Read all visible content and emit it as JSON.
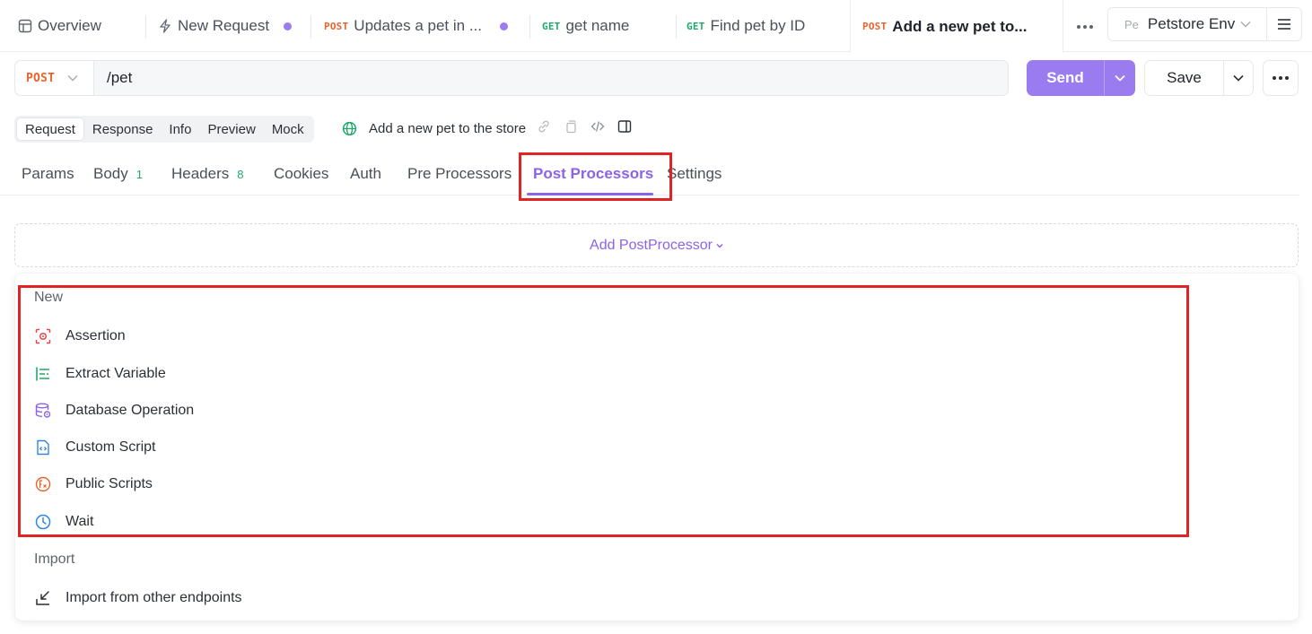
{
  "tabs": [
    {
      "label": "Overview",
      "method": "",
      "icon": "layout-icon",
      "unsaved": false,
      "active": false
    },
    {
      "label": "New Request",
      "method": "",
      "icon": "lightning-icon",
      "unsaved": true,
      "active": false
    },
    {
      "label": "Updates a pet in ...",
      "method": "POST",
      "unsaved": true,
      "active": false
    },
    {
      "label": "get name",
      "method": "GET",
      "unsaved": false,
      "active": false
    },
    {
      "label": "Find pet by ID",
      "method": "GET",
      "unsaved": false,
      "active": false
    },
    {
      "label": "Add a new pet to...",
      "method": "POST",
      "unsaved": false,
      "active": true
    }
  ],
  "environment": {
    "badge": "Pe",
    "name": "Petstore Env"
  },
  "request": {
    "method": "POST",
    "url": "/pet",
    "send_label": "Send",
    "save_label": "Save"
  },
  "view_modes": [
    "Request",
    "Response",
    "Info",
    "Preview",
    "Mock"
  ],
  "active_view_mode": "Request",
  "request_name": "Add a new pet to the store",
  "subtabs": [
    {
      "label": "Params",
      "count": ""
    },
    {
      "label": "Body",
      "count": "1"
    },
    {
      "label": "Headers",
      "count": "8"
    },
    {
      "label": "Cookies",
      "count": ""
    },
    {
      "label": "Auth",
      "count": ""
    },
    {
      "label": "Pre Processors",
      "count": ""
    },
    {
      "label": "Post Processors",
      "count": ""
    },
    {
      "label": "Settings",
      "count": ""
    }
  ],
  "active_subtab": "Post Processors",
  "add_processor_label": "Add PostProcessor",
  "dropdown": {
    "new_group_label": "New",
    "new_items": [
      {
        "label": "Assertion",
        "icon": "assertion-icon"
      },
      {
        "label": "Extract Variable",
        "icon": "extract-variable-icon"
      },
      {
        "label": "Database Operation",
        "icon": "database-icon"
      },
      {
        "label": "Custom Script",
        "icon": "script-file-icon"
      },
      {
        "label": "Public Scripts",
        "icon": "function-icon"
      },
      {
        "label": "Wait",
        "icon": "clock-icon"
      }
    ],
    "import_group_label": "Import",
    "import_items": [
      {
        "label": "Import from other endpoints",
        "icon": "import-icon"
      }
    ]
  },
  "colors": {
    "accent": "#8a63e8",
    "send_button": "#9b7bf0",
    "post_method": "#e8632b",
    "get_method": "#20a86b",
    "highlight": "#e02424"
  }
}
